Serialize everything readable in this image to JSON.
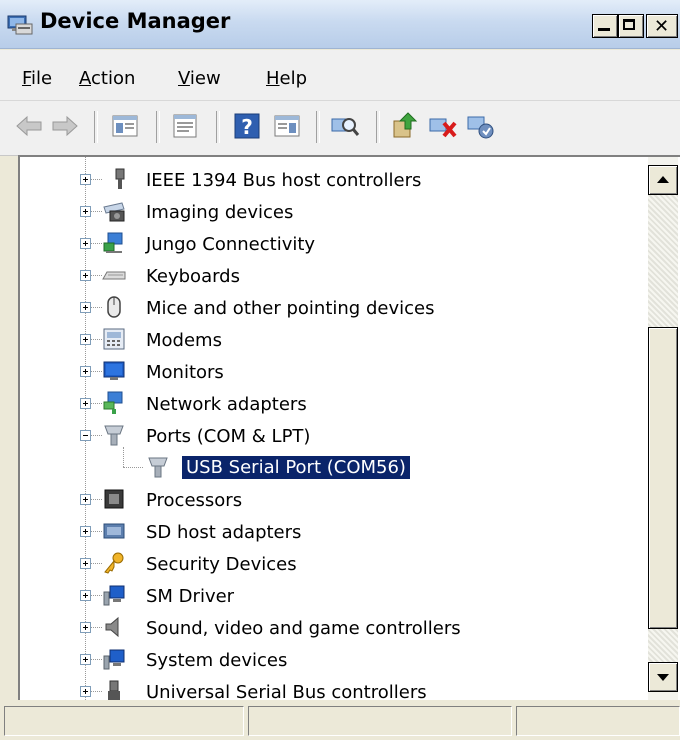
{
  "window": {
    "title": "Device Manager"
  },
  "menu": [
    {
      "label": "File",
      "accel": "F",
      "rest": "ile"
    },
    {
      "label": "Action",
      "accel": "A",
      "rest": "ction"
    },
    {
      "label": "View",
      "accel": "V",
      "rest": "iew"
    },
    {
      "label": "Help",
      "accel": "H",
      "rest": "elp"
    }
  ],
  "toolbar": {
    "buttons": [
      "back-arrow-icon",
      "forward-arrow-icon",
      "show-hide-tree-icon",
      "properties-icon",
      "help-icon",
      "action-pane-icon",
      "scan-hardware-icon",
      "update-driver-icon",
      "uninstall-device-icon",
      "disable-device-icon"
    ]
  },
  "tree": {
    "items": [
      {
        "label": "IEEE 1394 Bus host controllers",
        "icon": "firewire-plug-icon",
        "expanded": false
      },
      {
        "label": "Imaging devices",
        "icon": "scanner-icon",
        "expanded": false
      },
      {
        "label": "Jungo Connectivity",
        "icon": "network-monitor-icon",
        "expanded": false
      },
      {
        "label": "Keyboards",
        "icon": "keyboard-icon",
        "expanded": false
      },
      {
        "label": "Mice and other pointing devices",
        "icon": "mouse-icon",
        "expanded": false
      },
      {
        "label": "Modems",
        "icon": "modem-icon",
        "expanded": false
      },
      {
        "label": "Monitors",
        "icon": "monitor-icon",
        "expanded": false
      },
      {
        "label": "Network adapters",
        "icon": "network-adapter-icon",
        "expanded": false
      },
      {
        "label": "Ports (COM & LPT)",
        "icon": "port-plug-icon",
        "expanded": true
      },
      {
        "label": "Processors",
        "icon": "processor-chip-icon",
        "expanded": false
      },
      {
        "label": "SD host adapters",
        "icon": "sd-card-icon",
        "expanded": false
      },
      {
        "label": "Security Devices",
        "icon": "key-icon",
        "expanded": false
      },
      {
        "label": "SM Driver",
        "icon": "computer-icon",
        "expanded": false
      },
      {
        "label": "Sound, video and game controllers",
        "icon": "speaker-icon",
        "expanded": false
      },
      {
        "label": "System devices",
        "icon": "computer-icon",
        "expanded": false
      },
      {
        "label": "Universal Serial Bus controllers",
        "icon": "usb-plug-icon",
        "expanded": false
      }
    ],
    "selected_child": {
      "label": "USB Serial Port (COM56)",
      "icon": "port-plug-icon"
    }
  },
  "colors": {
    "selection": "#0a246a",
    "window_face": "#ece9d8"
  }
}
